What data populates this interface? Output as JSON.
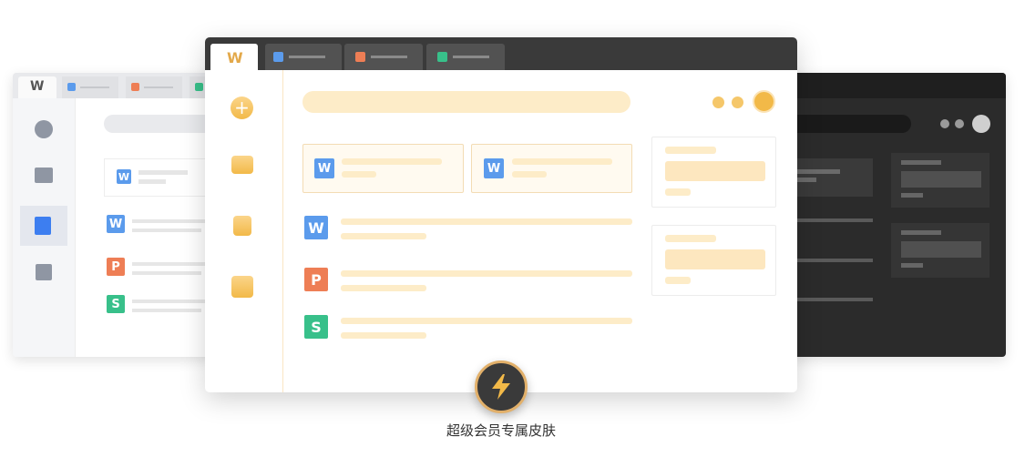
{
  "caption": "超级会员专属皮肤",
  "icons": {
    "wps_logo": "wps-logo-icon",
    "word": "word-doc-icon",
    "ppt": "ppt-doc-icon",
    "sheet": "spreadsheet-doc-icon",
    "bolt": "lightning-bolt-icon"
  },
  "glyphs": {
    "word": "W",
    "ppt": "P",
    "sheet": "S",
    "logo": "W"
  },
  "colors": {
    "accent_gold": "#f2b948",
    "cream": "#fdecc8",
    "dark_skin": "#2b2b2b",
    "light_skin": "#fafafa"
  }
}
